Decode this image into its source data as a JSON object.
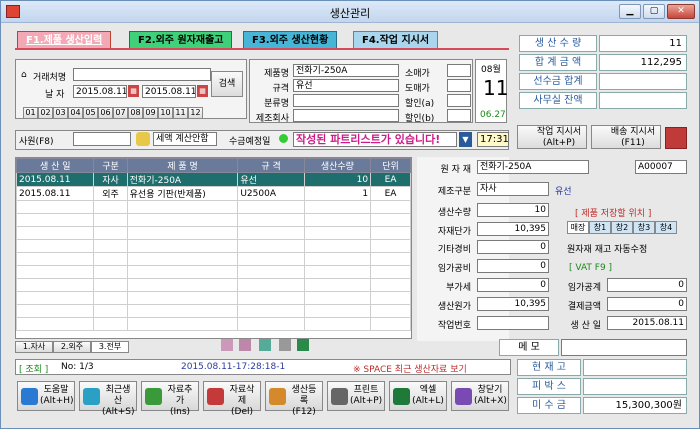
{
  "window": {
    "title": "생산관리"
  },
  "tabs": [
    {
      "label": "F1.제품 생산입력",
      "color": "#f3a9b5"
    },
    {
      "label": "F2.외주 원자재출고",
      "color": "#3fd07a"
    },
    {
      "label": "F3.외주 생산현황",
      "color": "#46b5d6"
    },
    {
      "label": "F4.작업 지시서",
      "color": "#a9d6ec"
    }
  ],
  "filter": {
    "customer_label": "거래처명",
    "date_label": "날 자",
    "date_from": "2015.08.11",
    "date_to": "2015.08.11",
    "search_btn": "검색",
    "months": [
      "01",
      "02",
      "03",
      "04",
      "05",
      "06",
      "07",
      "08",
      "09",
      "10",
      "11",
      "12"
    ]
  },
  "product_info": {
    "labels": [
      "제품명",
      "규격",
      "분류명",
      "제조회사"
    ],
    "values": [
      "전화기-250A",
      "유선",
      "",
      ""
    ],
    "right_labels": [
      "소매가",
      "도매가",
      "할인(a)",
      "할인(b)"
    ],
    "right_values": [
      "",
      "",
      "",
      ""
    ]
  },
  "calendar": {
    "month": "08월",
    "day": "11",
    "date": "06.27"
  },
  "summary": [
    {
      "label": "생 산 수 량",
      "value": "11"
    },
    {
      "label": "합 계 금 액",
      "value": "112,295"
    },
    {
      "label": "선수금 합계",
      "value": ""
    },
    {
      "label": "사무실 잔액",
      "value": ""
    }
  ],
  "bar2": {
    "staff": "사원(F8)",
    "tax_calc": "세액 계산안함",
    "collect": "수금예정일",
    "notice": "작성된 파트리스트가 있습니다!",
    "time": "17:31",
    "work_order_btn": "작업 지시서\n(Alt+P)",
    "delivery_btn": "배송 지시서\n(F11)"
  },
  "grid": {
    "headers": [
      "생 산 일",
      "구분",
      "제 품 명",
      "규 격",
      "생산수량",
      "단위"
    ],
    "rows": [
      [
        "2015.08.11",
        "자사",
        "전화기-250A",
        "유선",
        "10",
        "EA"
      ],
      [
        "2015.08.11",
        "외주",
        "유선용 기판(반제품)",
        "U2500A",
        "1",
        "EA"
      ]
    ]
  },
  "detail": {
    "material_label": "원 자 재",
    "material_value": "전화기-250A",
    "material_code": "A00007",
    "type_label": "제조구분",
    "type_value": "자사",
    "type_note": "유선",
    "qty_label": "생산수량",
    "qty_value": "10",
    "storage_note": "[ 제품 저장할 위치 ]",
    "unit_price_label": "자재단가",
    "unit_price_value": "10,395",
    "store_tabs": [
      "매장",
      "창1",
      "창2",
      "창3",
      "창4"
    ],
    "other_cost_label": "기타경비",
    "other_cost_value": "0",
    "auto_adjust": "원자재 재고 자동수정",
    "labor_label": "임가공비",
    "labor_value": "0",
    "vat_note": "[ VAT F9 ]",
    "vat_label": "부가세",
    "vat_value": "0",
    "labor_total_label": "임가공계",
    "labor_total_value": "0",
    "cost_label": "생산원가",
    "cost_value": "10,395",
    "pay_label": "결제금액",
    "pay_value": "0",
    "work_no_label": "작업번호",
    "work_no_value": "",
    "prod_date_label": "생 산 일",
    "prod_date_value": "2015.08.11"
  },
  "bottom_tabs": [
    "1.자사",
    "2.외주",
    "3.전부"
  ],
  "memo_label": "메 모",
  "status": {
    "mode": "[ 조회 ]",
    "page": "No: 1/3",
    "stamp": "2015.08.11-17:28:18-1",
    "hint": "※ SPACE 최근 생산자료 보기"
  },
  "right_info": [
    {
      "label": "현 재 고",
      "value": ""
    },
    {
      "label": "피 박 스",
      "value": ""
    },
    {
      "label": "미 수 금",
      "value": "15,300,300원"
    }
  ],
  "toolbar": [
    {
      "label": "도움말\n(Alt+H)",
      "icon": "help-icon",
      "color": "#2a7ad4"
    },
    {
      "label": "최근생산\n(Alt+S)",
      "icon": "recent-icon",
      "color": "#2aa0c4"
    },
    {
      "label": "자료추가\n(Ins)",
      "icon": "add-icon",
      "color": "#3a9a3a"
    },
    {
      "label": "자료삭제\n(Del)",
      "icon": "delete-icon",
      "color": "#c43a3a"
    },
    {
      "label": "생산등록\n(F12)",
      "icon": "register-icon",
      "color": "#d48a2a"
    },
    {
      "label": "프린트\n(Alt+P)",
      "icon": "print-icon",
      "color": "#666666"
    },
    {
      "label": "엑셀\n(Alt+L)",
      "icon": "excel-icon",
      "color": "#1f7a3a"
    },
    {
      "label": "창닫기\n(Alt+X)",
      "icon": "close-window-icon",
      "color": "#7a4ab4"
    }
  ]
}
